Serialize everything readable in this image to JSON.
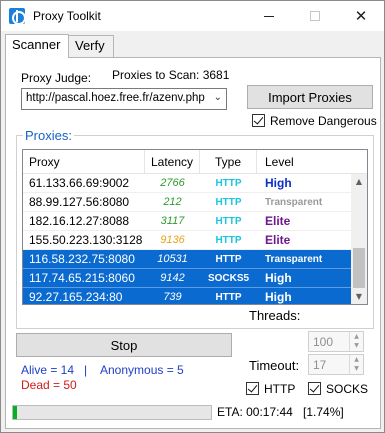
{
  "window": {
    "title": "Proxy Toolkit",
    "icon": "app-globe-icon",
    "minimize": "minimize-icon",
    "maximize": "maximize-icon",
    "close_glyph": "✕"
  },
  "tabs": [
    {
      "label": "Scanner",
      "active": true
    },
    {
      "label": "Verfy",
      "active": false
    }
  ],
  "scanner": {
    "proxy_judge_label": "Proxy Judge:",
    "proxies_to_scan": "Proxies to Scan: 3681",
    "judge_url": "http://pascal.hoez.free.fr/azenv.php",
    "import_button": "Import Proxies",
    "remove_dangerous": "Remove Dangerous",
    "remove_dangerous_checked": true
  },
  "proxies": {
    "group_title": "Proxies:",
    "columns": [
      "Proxy",
      "Latency",
      "Type",
      "Level"
    ],
    "rows": [
      {
        "proxy": "61.133.66.69:9002",
        "latency": "2766",
        "type": "HTTP",
        "level": "High",
        "selected": false
      },
      {
        "proxy": "88.99.127.56:8080",
        "latency": "212",
        "type": "HTTP",
        "level": "Transparent",
        "selected": false
      },
      {
        "proxy": "182.16.12.27:8088",
        "latency": "3117",
        "type": "HTTP",
        "level": "Elite",
        "selected": false
      },
      {
        "proxy": "155.50.223.130:3128",
        "latency": "9136",
        "type": "HTTP",
        "level": "Elite",
        "selected": false
      },
      {
        "proxy": "116.58.232.75:8080",
        "latency": "10531",
        "type": "HTTP",
        "level": "Transparent",
        "selected": true
      },
      {
        "proxy": "117.74.65.215:8060",
        "latency": "9142",
        "type": "SOCKS5",
        "level": "High",
        "selected": true
      },
      {
        "proxy": "92.27.165.234:80",
        "latency": "739",
        "type": "HTTP",
        "level": "High",
        "selected": true
      }
    ]
  },
  "colors": {
    "latency_fast": "#2e9a2e",
    "latency_slow": "#e8a317",
    "type_http": "#19c5df",
    "level_high": "#0b2fc7",
    "level_elite": "#6f1a8c",
    "level_transparent": "#9a9a9a",
    "alive": "#1d3fc7",
    "dead": "#d11a1a",
    "progress": "#06b025"
  },
  "controls": {
    "stop_button": "Stop",
    "threads_label": "Threads:",
    "threads_value": "100",
    "timeout_label": "Timeout:",
    "timeout_value": "17",
    "http_label": "HTTP",
    "http_checked": true,
    "socks_label": "SOCKS",
    "socks_checked": true
  },
  "stats": {
    "alive": "Alive = 14",
    "separator": "|",
    "anonymous": "Anonymous = 5",
    "dead": "Dead = 50"
  },
  "status": {
    "progress_fraction": 0.0174,
    "eta": "ETA: 00:17:44",
    "percent": "[1.74%]"
  }
}
